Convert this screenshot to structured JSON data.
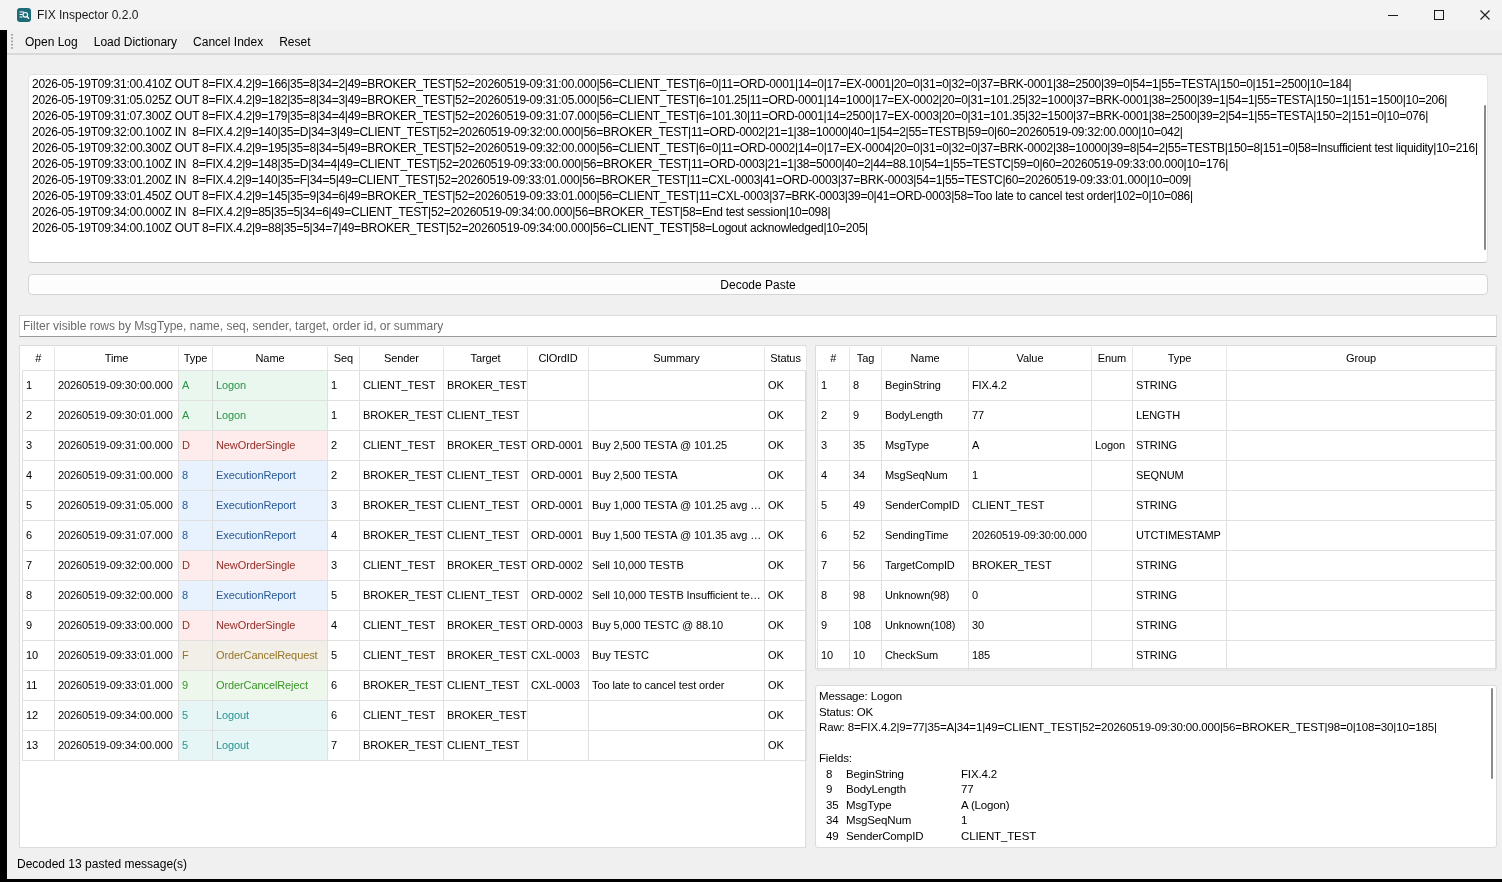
{
  "window": {
    "title": "FIX Inspector 0.2.0"
  },
  "toolbar": {
    "items": [
      "Open Log",
      "Load Dictionary",
      "Cancel Index",
      "Reset"
    ]
  },
  "log": {
    "lines": [
      "2026-05-19T09:31:00.410Z OUT 8=FIX.4.2|9=166|35=8|34=2|49=BROKER_TEST|52=20260519-09:31:00.000|56=CLIENT_TEST|6=0|11=ORD-0001|14=0|17=EX-0001|20=0|31=0|32=0|37=BRK-0001|38=2500|39=0|54=1|55=TESTA|150=0|151=2500|10=184|",
      "2026-05-19T09:31:05.025Z OUT 8=FIX.4.2|9=182|35=8|34=3|49=BROKER_TEST|52=20260519-09:31:05.000|56=CLIENT_TEST|6=101.25|11=ORD-0001|14=1000|17=EX-0002|20=0|31=101.25|32=1000|37=BRK-0001|38=2500|39=1|54=1|55=TESTA|150=1|151=1500|10=206|",
      "2026-05-19T09:31:07.300Z OUT 8=FIX.4.2|9=179|35=8|34=4|49=BROKER_TEST|52=20260519-09:31:07.000|56=CLIENT_TEST|6=101.30|11=ORD-0001|14=2500|17=EX-0003|20=0|31=101.35|32=1500|37=BRK-0001|38=2500|39=2|54=1|55=TESTA|150=2|151=0|10=076|",
      "2026-05-19T09:32:00.100Z IN  8=FIX.4.2|9=140|35=D|34=3|49=CLIENT_TEST|52=20260519-09:32:00.000|56=BROKER_TEST|11=ORD-0002|21=1|38=10000|40=1|54=2|55=TESTB|59=0|60=20260519-09:32:00.000|10=042|",
      "2026-05-19T09:32:00.300Z OUT 8=FIX.4.2|9=195|35=8|34=5|49=BROKER_TEST|52=20260519-09:32:00.000|56=CLIENT_TEST|6=0|11=ORD-0002|14=0|17=EX-0004|20=0|31=0|32=0|37=BRK-0002|38=10000|39=8|54=2|55=TESTB|150=8|151=0|58=Insufficient test liquidity|10=216|",
      "2026-05-19T09:33:00.100Z IN  8=FIX.4.2|9=148|35=D|34=4|49=CLIENT_TEST|52=20260519-09:33:00.000|56=BROKER_TEST|11=ORD-0003|21=1|38=5000|40=2|44=88.10|54=1|55=TESTC|59=0|60=20260519-09:33:00.000|10=176|",
      "2026-05-19T09:33:01.200Z IN  8=FIX.4.2|9=140|35=F|34=5|49=CLIENT_TEST|52=20260519-09:33:01.000|56=BROKER_TEST|11=CXL-0003|41=ORD-0003|37=BRK-0003|54=1|55=TESTC|60=20260519-09:33:01.000|10=009|",
      "2026-05-19T09:33:01.450Z OUT 8=FIX.4.2|9=145|35=9|34=6|49=BROKER_TEST|52=20260519-09:33:01.000|56=CLIENT_TEST|11=CXL-0003|37=BRK-0003|39=0|41=ORD-0003|58=Too late to cancel test order|102=0|10=086|",
      "2026-05-19T09:34:00.000Z IN  8=FIX.4.2|9=85|35=5|34=6|49=CLIENT_TEST|52=20260519-09:34:00.000|56=BROKER_TEST|58=End test session|10=098|",
      "2026-05-19T09:34:00.100Z OUT 8=FIX.4.2|9=88|35=5|34=7|49=BROKER_TEST|52=20260519-09:34:00.000|56=CLIENT_TEST|58=Logout acknowledged|10=205|"
    ]
  },
  "decode_button": {
    "label": "Decode Paste"
  },
  "filter": {
    "placeholder": "Filter visible rows by MsgType, name, seq, sender, target, order id, or summary"
  },
  "messages": {
    "columns": [
      "#",
      "Time",
      "Type",
      "Name",
      "Seq",
      "Sender",
      "Target",
      "ClOrdID",
      "Summary",
      "Status"
    ],
    "rows": [
      {
        "num": "1",
        "time": "20260519-09:30:00.000",
        "type": "A",
        "name": "Logon",
        "seq": "1",
        "sender": "CLIENT_TEST",
        "target": "BROKER_TEST",
        "status": "OK",
        "color": "#eaf7ee"
      },
      {
        "num": "2",
        "time": "20260519-09:30:01.000",
        "type": "A",
        "name": "Logon",
        "seq": "1",
        "sender": "BROKER_TEST",
        "target": "CLIENT_TEST",
        "status": "OK",
        "color": "#eaf7ee"
      },
      {
        "num": "3",
        "time": "20260519-09:31:00.000",
        "type": "D",
        "name": "NewOrderSingle",
        "seq": "2",
        "sender": "CLIENT_TEST",
        "target": "BROKER_TEST",
        "clordid": "ORD-0001",
        "summary": "Buy 2,500 TESTA @ 101.25",
        "status": "OK",
        "color": "#fdeceb"
      },
      {
        "num": "4",
        "time": "20260519-09:31:00.000",
        "type": "8",
        "name": "ExecutionReport",
        "seq": "2",
        "sender": "BROKER_TEST",
        "target": "CLIENT_TEST",
        "clordid": "ORD-0001",
        "summary": "Buy 2,500 TESTA",
        "status": "OK",
        "color": "#e8f2fe"
      },
      {
        "num": "5",
        "time": "20260519-09:31:05.000",
        "type": "8",
        "name": "ExecutionReport",
        "seq": "3",
        "sender": "BROKER_TEST",
        "target": "CLIENT_TEST",
        "clordid": "ORD-0001",
        "summary": "Buy 1,000 TESTA @ 101.25 avg …",
        "status": "OK",
        "color": "#e8f2fe"
      },
      {
        "num": "6",
        "time": "20260519-09:31:07.000",
        "type": "8",
        "name": "ExecutionReport",
        "seq": "4",
        "sender": "BROKER_TEST",
        "target": "CLIENT_TEST",
        "clordid": "ORD-0001",
        "summary": "Buy 1,500 TESTA @ 101.35 avg …",
        "status": "OK",
        "color": "#e8f2fe"
      },
      {
        "num": "7",
        "time": "20260519-09:32:00.000",
        "type": "D",
        "name": "NewOrderSingle",
        "seq": "3",
        "sender": "CLIENT_TEST",
        "target": "BROKER_TEST",
        "clordid": "ORD-0002",
        "summary": "Sell 10,000 TESTB",
        "status": "OK",
        "color": "#fdeceb"
      },
      {
        "num": "8",
        "time": "20260519-09:32:00.000",
        "type": "8",
        "name": "ExecutionReport",
        "seq": "5",
        "sender": "BROKER_TEST",
        "target": "CLIENT_TEST",
        "clordid": "ORD-0002",
        "summary": "Sell 10,000 TESTB Insufficient te…",
        "status": "OK",
        "color": "#e8f2fe"
      },
      {
        "num": "9",
        "time": "20260519-09:33:00.000",
        "type": "D",
        "name": "NewOrderSingle",
        "seq": "4",
        "sender": "CLIENT_TEST",
        "target": "BROKER_TEST",
        "clordid": "ORD-0003",
        "summary": "Buy 5,000 TESTC @ 88.10",
        "status": "OK",
        "color": "#fdeceb"
      },
      {
        "num": "10",
        "time": "20260519-09:33:01.000",
        "type": "F",
        "name": "OrderCancelRequest",
        "seq": "5",
        "sender": "CLIENT_TEST",
        "target": "BROKER_TEST",
        "clordid": "CXL-0003",
        "summary": "Buy TESTC",
        "status": "OK",
        "color": "#f2efe8"
      },
      {
        "num": "11",
        "time": "20260519-09:33:01.000",
        "type": "9",
        "name": "OrderCancelReject",
        "seq": "6",
        "sender": "BROKER_TEST",
        "target": "CLIENT_TEST",
        "clordid": "CXL-0003",
        "summary": "Too late to cancel test order",
        "status": "OK",
        "color": "#edf7eb"
      },
      {
        "num": "12",
        "time": "20260519-09:34:00.000",
        "type": "5",
        "name": "Logout",
        "seq": "6",
        "sender": "CLIENT_TEST",
        "target": "BROKER_TEST",
        "status": "OK",
        "color": "#e6f6f6"
      },
      {
        "num": "13",
        "time": "20260519-09:34:00.000",
        "type": "5",
        "name": "Logout",
        "seq": "7",
        "sender": "BROKER_TEST",
        "target": "CLIENT_TEST",
        "status": "OK",
        "color": "#e6f6f6"
      }
    ]
  },
  "fields": {
    "columns": [
      "#",
      "Tag",
      "Name",
      "Value",
      "Enum",
      "Type",
      "Group"
    ],
    "rows": [
      {
        "num": "1",
        "tag": "8",
        "name": "BeginString",
        "value": "FIX.4.2",
        "type": "STRING"
      },
      {
        "num": "2",
        "tag": "9",
        "name": "BodyLength",
        "value": "77",
        "type": "LENGTH"
      },
      {
        "num": "3",
        "tag": "35",
        "name": "MsgType",
        "value": "A",
        "enum": "Logon",
        "type": "STRING"
      },
      {
        "num": "4",
        "tag": "34",
        "name": "MsgSeqNum",
        "value": "1",
        "type": "SEQNUM"
      },
      {
        "num": "5",
        "tag": "49",
        "name": "SenderCompID",
        "value": "CLIENT_TEST",
        "type": "STRING"
      },
      {
        "num": "6",
        "tag": "52",
        "name": "SendingTime",
        "value": "20260519-09:30:00.000",
        "type": "UTCTIMESTAMP"
      },
      {
        "num": "7",
        "tag": "56",
        "name": "TargetCompID",
        "value": "BROKER_TEST",
        "type": "STRING"
      },
      {
        "num": "8",
        "tag": "98",
        "name": "Unknown(98)",
        "value": "0",
        "type": "STRING"
      },
      {
        "num": "9",
        "tag": "108",
        "name": "Unknown(108)",
        "value": "30",
        "type": "STRING"
      },
      {
        "num": "10",
        "tag": "10",
        "name": "CheckSum",
        "value": "185",
        "type": "STRING"
      }
    ]
  },
  "detail": {
    "lines": [
      "Message: Logon",
      "Status: OK",
      "Raw: 8=FIX.4.2|9=77|35=A|34=1|49=CLIENT_TEST|52=20260519-09:30:00.000|56=BROKER_TEST|98=0|108=30|10=185|"
    ],
    "fields_heading": "Fields:",
    "fields": [
      {
        "tag": "8",
        "name": "BeginString",
        "value": "FIX.4.2"
      },
      {
        "tag": "9",
        "name": "BodyLength",
        "value": "77"
      },
      {
        "tag": "35",
        "name": "MsgType",
        "value": "A (Logon)"
      },
      {
        "tag": "34",
        "name": "MsgSeqNum",
        "value": "1"
      },
      {
        "tag": "49",
        "name": "SenderCompID",
        "value": "CLIENT_TEST"
      }
    ]
  },
  "status_bar": {
    "text": "Decoded 13 pasted message(s)"
  }
}
